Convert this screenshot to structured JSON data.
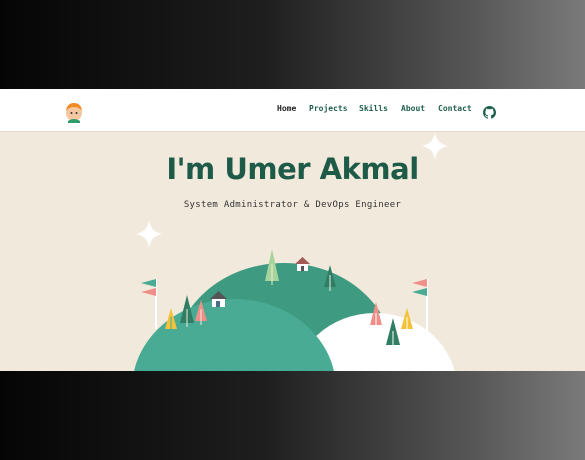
{
  "nav": {
    "links": [
      {
        "label": "Home"
      },
      {
        "label": "Projects"
      },
      {
        "label": "Skills"
      },
      {
        "label": "About"
      },
      {
        "label": "Contact"
      }
    ]
  },
  "hero": {
    "title": "I'm Umer Akmal",
    "subtitle": "System Administrator & DevOps Engineer"
  },
  "colors": {
    "accent": "#1e5a48",
    "background": "#f2e9dd",
    "hill_teal": "#4aab95",
    "hill_dark": "#3e9a80",
    "hill_white": "#ffffff"
  },
  "icons": [
    "avatar-logo",
    "github-icon",
    "sparkle-icon",
    "flag-icon",
    "tree-icon",
    "house-icon"
  ]
}
